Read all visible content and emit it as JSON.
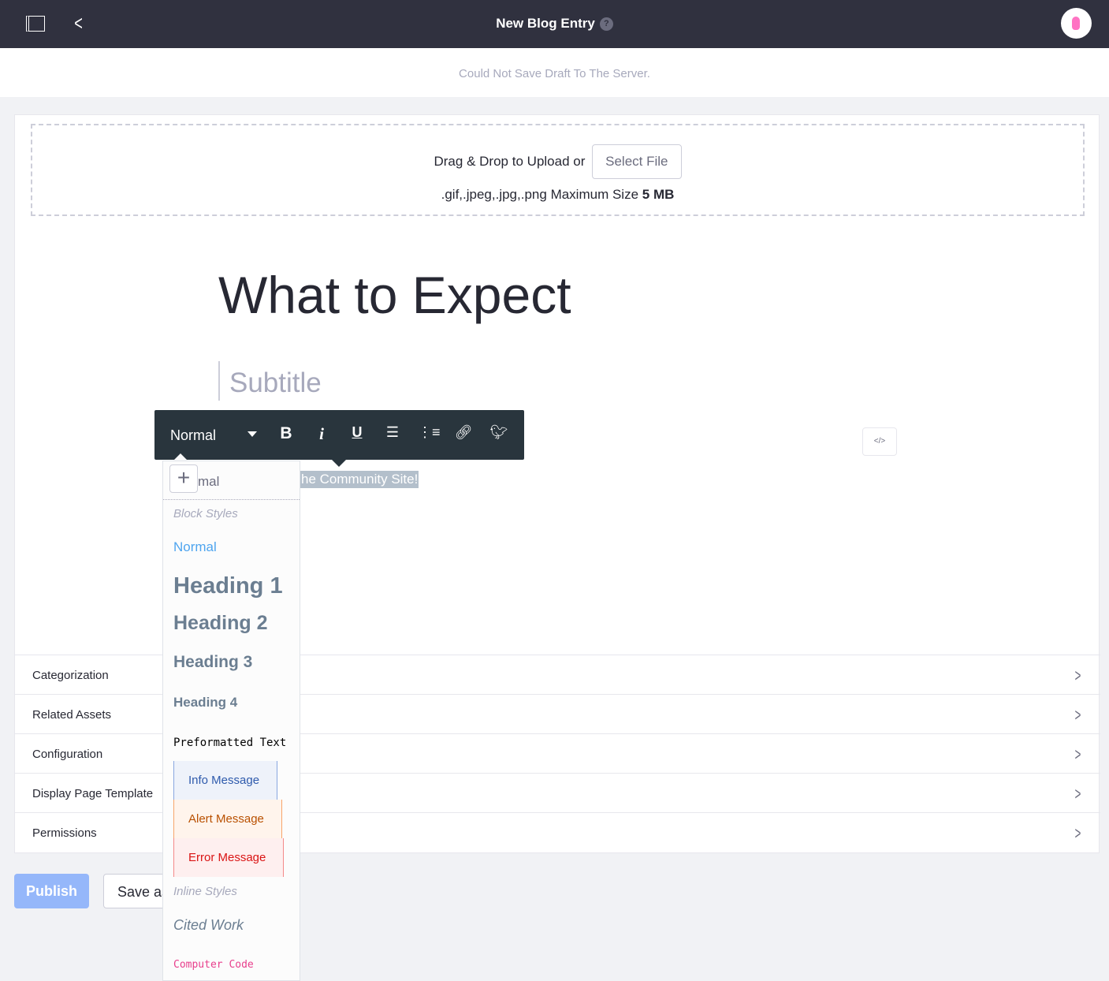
{
  "header": {
    "title": "New Blog Entry",
    "help_icon": "?",
    "sidebar_icon": "sidebar-toggle-icon",
    "back_icon": "chevron-left-icon",
    "avatar_icon": "user-icon"
  },
  "notice": "Could Not Save Draft To The Server.",
  "upload": {
    "drag": "Drag",
    "amp": "&",
    "drop": "Drop",
    "to": "to",
    "upload": "Upload",
    "or": "or",
    "select_file": "Select File",
    "types": ".gif,.jpeg,.jpg,.png",
    "max_label": "Maximum Size",
    "max_value": "5 MB"
  },
  "editor": {
    "title": "What to Expect",
    "subtitle_placeholder": "Subtitle",
    "selected_text": "he Community Site!",
    "code_button": "</>"
  },
  "toolbar": {
    "format": "Normal",
    "buttons": [
      "bold",
      "italic",
      "underline",
      "ordered-list",
      "unordered-list",
      "link",
      "twitter"
    ]
  },
  "dropdown": {
    "current": "mal",
    "block_styles": "Block Styles",
    "items": [
      "Normal",
      "Heading 1",
      "Heading 2",
      "Heading 3",
      "Heading 4",
      "Preformatted Text",
      "Info Message",
      "Alert Message",
      "Error Message"
    ],
    "inline_styles": "Inline Styles",
    "inline_items": [
      "Cited Work",
      "Computer Code"
    ]
  },
  "panels": [
    "Categorization",
    "Related Assets",
    "Configuration",
    "Display Page Template",
    "Permissions"
  ],
  "actions": {
    "publish": "Publish",
    "save": "Save as"
  }
}
